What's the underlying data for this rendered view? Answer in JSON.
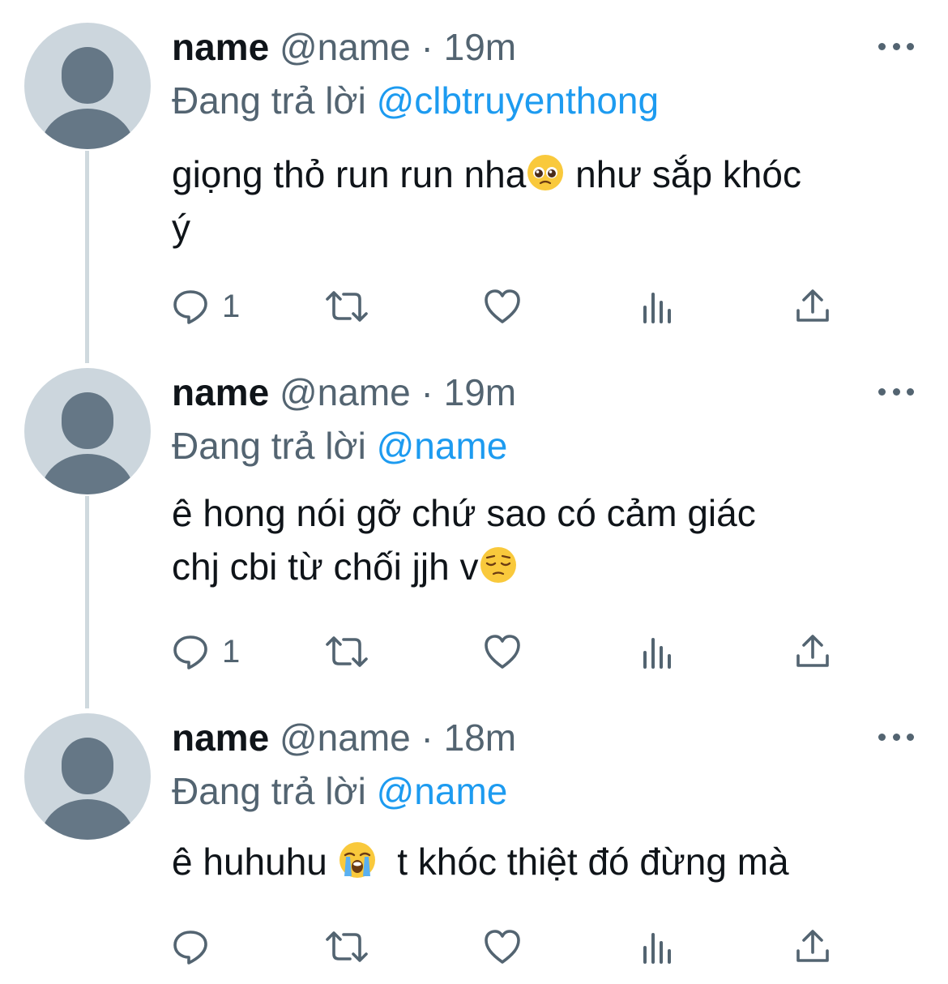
{
  "tweets": [
    {
      "name": "name",
      "handle": "@name",
      "separator": "·",
      "time": "19m",
      "reply_prefix": "Đang trả lời",
      "reply_to": "@clbtruyenthong",
      "text_part1": "giọng thỏ run run nha",
      "emoji1": "pleading-face",
      "text_part2": " như sắp khóc\ný",
      "reply_count": "1"
    },
    {
      "name": "name",
      "handle": "@name",
      "separator": "·",
      "time": "19m",
      "reply_prefix": "Đang trả lời",
      "reply_to": "@name",
      "text_part1": "ê hong nói gỡ chứ sao có cảm giác\nchj cbi từ chối jjh v",
      "emoji1": "pensive-face",
      "text_part2": "",
      "reply_count": "1"
    },
    {
      "name": "name",
      "handle": "@name",
      "separator": "·",
      "time": "18m",
      "reply_prefix": "Đang trả lời",
      "reply_to": "@name",
      "text_part1": "ê huhuhu ",
      "emoji1": "loudly-crying-face",
      "text_part2": "  t khóc thiệt đó đừng mà",
      "reply_count": ""
    }
  ],
  "icons": [
    "reply-icon",
    "retweet-icon",
    "like-icon",
    "views-icon",
    "share-icon",
    "more-icon"
  ],
  "colors": {
    "link": "#1d9bf0",
    "secondary": "#536471",
    "avatar_bg": "#ccd6dd",
    "avatar_fg": "#657786",
    "thread_line": "#cfd9de"
  }
}
